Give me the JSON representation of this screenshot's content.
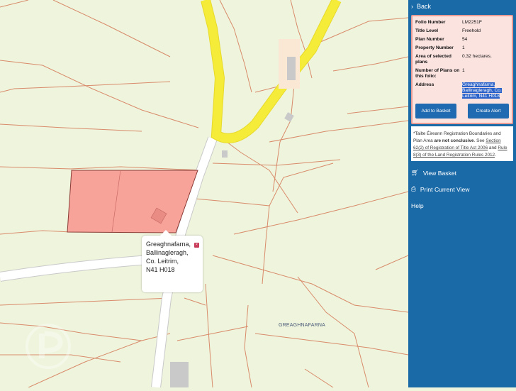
{
  "panel": {
    "back_label": "Back",
    "info": [
      {
        "key": "Folio Number",
        "value": "LM2251F"
      },
      {
        "key": "Title Level",
        "value": "Freehold"
      },
      {
        "key": "Plan Number",
        "value": "54"
      },
      {
        "key": "Property Number",
        "value": "1"
      },
      {
        "key": "Area of selected plans",
        "value": "0.32 hectares."
      },
      {
        "key": "Number of Plans on this folio:",
        "value": "1"
      }
    ],
    "address_key": "Address",
    "address_value": "Greaghnafarna, Ballinagleragh, Co. Leitrim, N41 H018",
    "add_basket_label": "Add to Basket",
    "create_alert_label": "Create Alert",
    "notice": {
      "part1": "*Tailte Éireann Registration Boundaries and Plan Area ",
      "bold": "are not conclusive",
      "part2": ". See ",
      "link1": "Section 62(2) of Registration of Title Act 2006",
      "part3": " and ",
      "link2": "Rule 8(3) of the Land Registration Rules 2012",
      "part4": "."
    },
    "view_basket_label": "View Basket",
    "print_label": "Print Current View",
    "help_label": "Help"
  },
  "map": {
    "popup_lines": [
      "Greaghnafarna,",
      "Ballinagleragh,",
      "Co. Leitrim,",
      "N41 H018"
    ],
    "townland_label": "GREAGHNAFARNA",
    "colors": {
      "background": "#eef5dc",
      "boundary": "#d98a6b",
      "road_major": "#f5ec3a",
      "road_minor": "#ffffff",
      "parcel_fill": "#f7a39a",
      "parcel_stroke": "#8a3a35",
      "panel": "#1a6aa8"
    }
  }
}
